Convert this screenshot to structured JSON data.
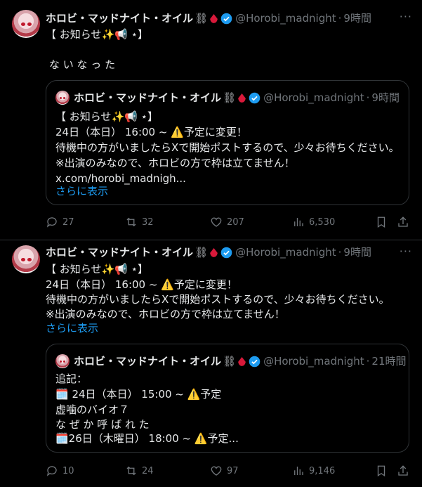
{
  "author": {
    "name": "ホロビ・マッドナイト・オイル",
    "chain_glyph": "⛓",
    "handle": "@Horobi_madnight",
    "dot": "·"
  },
  "more_glyph": "···",
  "tweets": [
    {
      "time": "9時間",
      "lines": [
        "【 お知らせ✨📢 ⋆】",
        "",
        "な い な っ た"
      ],
      "quote": {
        "time": "9時間",
        "lines": [
          "【 お知らせ✨📢 ⋆】",
          "24日（本日） 16:00 ~ ⚠️予定に変更！",
          "待機中の方がいましたらXで開始ポストするので、少々お待ちください。",
          "※出演のみなので、ホロビの方で枠は立てません！",
          "x.com/horobi_madnigh..."
        ],
        "show_more": "さらに表示"
      },
      "stats": {
        "replies": "27",
        "reposts": "32",
        "likes": "207",
        "views": "6,530"
      }
    },
    {
      "time": "9時間",
      "lines": [
        "【 お知らせ✨📢 ⋆】",
        "24日（本日） 16:00 ~ ⚠️予定に変更！",
        "待機中の方がいましたらXで開始ポストするので、少々お待ちください。",
        "※出演のみなので、ホロビの方で枠は立てません！"
      ],
      "show_more": "さらに表示",
      "quote": {
        "time": "21時間",
        "lines": [
          "追記：",
          "🗓️ 24日（本日） 15:00 ~ ⚠️予定",
          "虚噛のバイオ７",
          "な ぜ か 呼 ば れ た",
          "🗓️26日（木曜日） 18:00 ~ ⚠️予定..."
        ]
      },
      "stats": {
        "replies": "10",
        "reposts": "24",
        "likes": "97",
        "views": "9,146"
      }
    }
  ]
}
